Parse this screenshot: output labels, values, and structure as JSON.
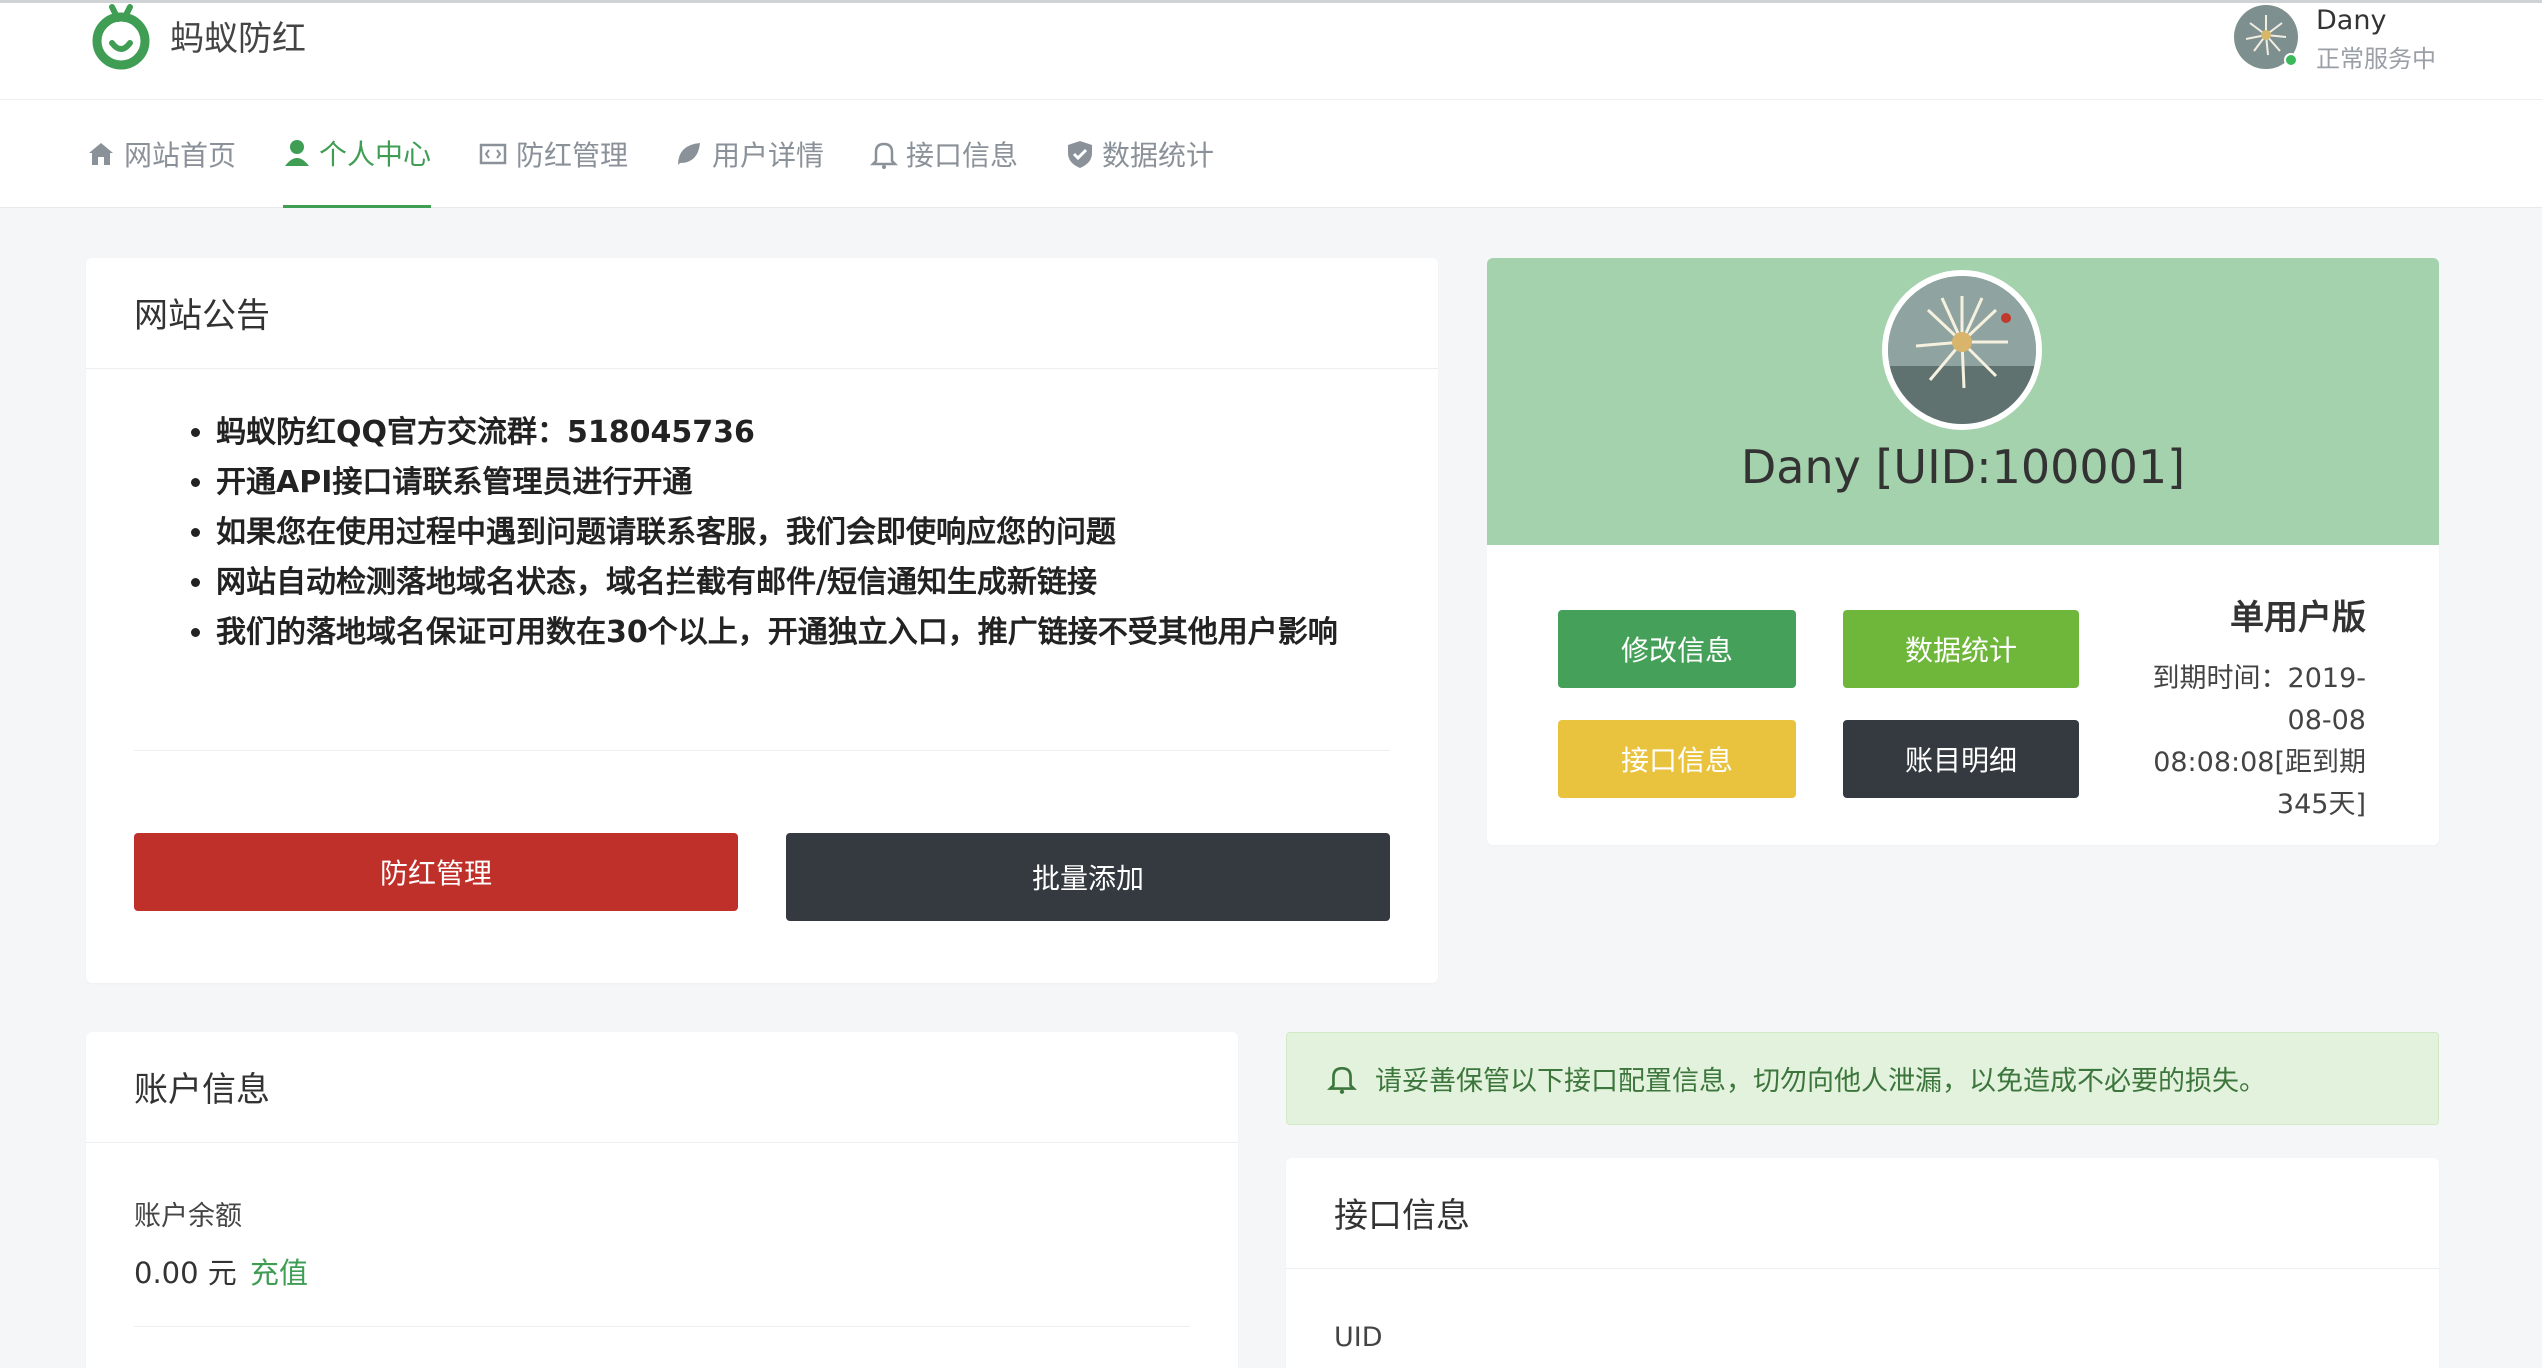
{
  "header": {
    "brand": "蚂蚁防红",
    "user_name": "Dany",
    "user_status": "正常服务中"
  },
  "nav": [
    {
      "label": "网站首页",
      "icon": "home-icon"
    },
    {
      "label": "个人中心",
      "icon": "user-icon",
      "active": true
    },
    {
      "label": "防红管理",
      "icon": "code-icon"
    },
    {
      "label": "用户详情",
      "icon": "leaf-icon"
    },
    {
      "label": "接口信息",
      "icon": "bell-icon"
    },
    {
      "label": "数据统计",
      "icon": "shield-icon"
    }
  ],
  "announcement": {
    "title": "网站公告",
    "items": [
      "蚂蚁防红QQ官方交流群：518045736",
      "开通API接口请联系管理员进行开通",
      "如果您在使用过程中遇到问题请联系客服，我们会即使响应您的问题",
      "网站自动检测落地域名状态，域名拦截有邮件/短信通知生成新链接",
      "我们的落地域名保证可用数在30个以上，开通独立入口，推广链接不受其他用户影响"
    ],
    "btn_manage": "防红管理",
    "btn_batch": "批量添加"
  },
  "profile": {
    "name": "Dany [UID:100001]",
    "btn_edit": "修改信息",
    "btn_stats": "数据统计",
    "btn_api": "接口信息",
    "btn_ledger": "账目明细",
    "plan": "单用户版",
    "expire": "到期时间：2019-08-08 08:08:08[距到期345天]"
  },
  "account": {
    "title": "账户信息",
    "balance_label": "账户余额",
    "balance_value": "0.00 元",
    "recharge": "充值"
  },
  "alert": {
    "text": "请妥善保管以下接口配置信息，切勿向他人泄漏，以免造成不必要的损失。"
  },
  "api": {
    "title": "接口信息",
    "uid_label": "UID"
  },
  "colors": {
    "primary": "#3f9d54",
    "danger": "#c0302a",
    "dark": "#343a40",
    "lime": "#6fb73a",
    "warning": "#e9c23e"
  }
}
